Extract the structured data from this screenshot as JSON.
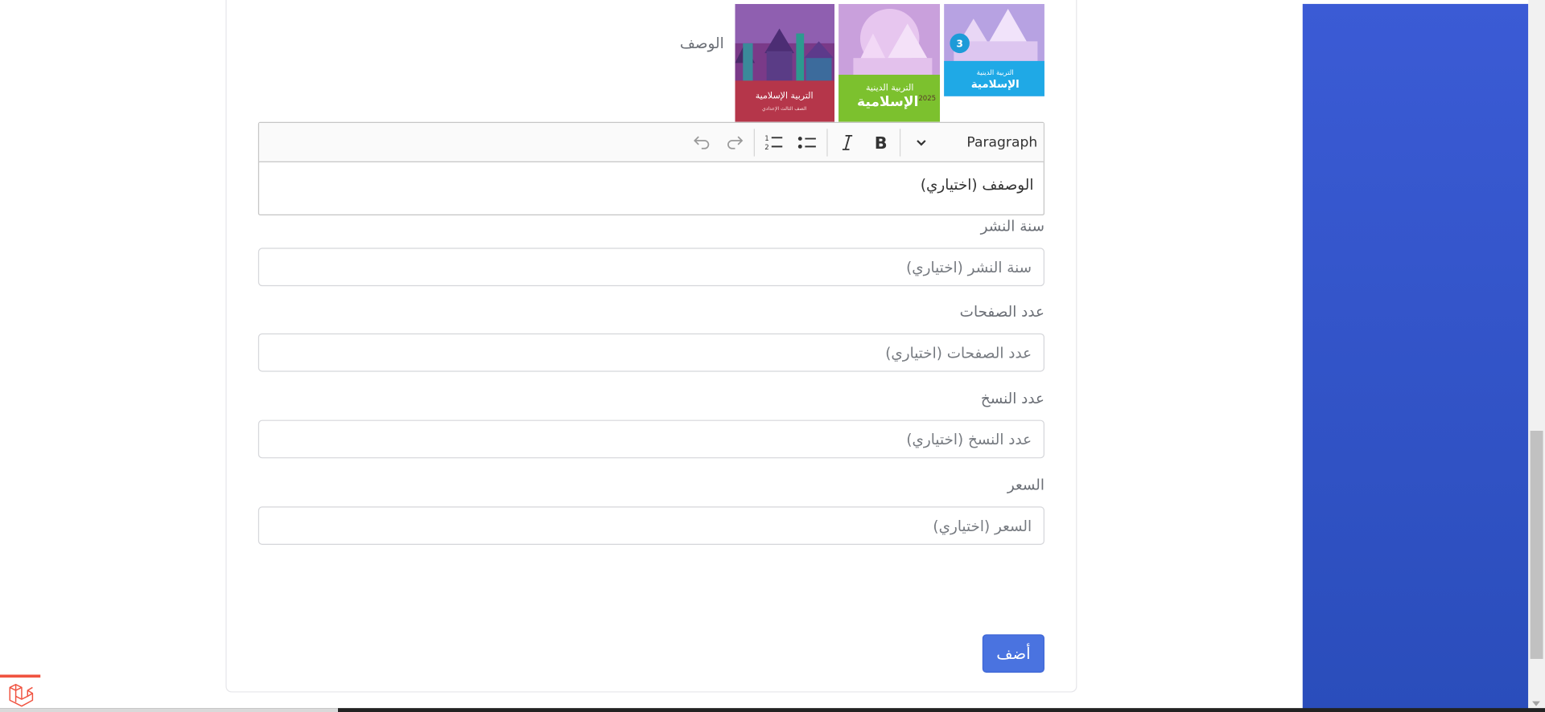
{
  "form": {
    "description_label": "الوصف",
    "editor": {
      "heading_dropdown": "Paragraph",
      "placeholder": "الوصفف (اختياري)"
    },
    "fields": [
      {
        "key": "year",
        "label": "سنة النشر",
        "placeholder": "سنة النشر (اختياري)"
      },
      {
        "key": "pages",
        "label": "عدد الصفحات",
        "placeholder": "عدد الصفحات (اختياري)"
      },
      {
        "key": "copies",
        "label": "عدد النسخ",
        "placeholder": "عدد النسخ (اختياري)"
      },
      {
        "key": "price",
        "label": "السعر",
        "placeholder": "السعر (اختياري)"
      }
    ],
    "submit_label": "أضف"
  },
  "images": [
    {
      "name": "book-cover-1",
      "colors": {
        "bg": "#6c2b8a",
        "accent": "#b5364a"
      }
    },
    {
      "name": "book-cover-2",
      "colors": {
        "bg": "#c48ad6",
        "accent": "#79bf2a"
      }
    },
    {
      "name": "book-cover-3",
      "colors": {
        "bg": "#a98cd6",
        "accent": "#1fa3e0"
      }
    }
  ],
  "colors": {
    "sidebar": "#3b5bd5",
    "primary_button": "#4a73e0",
    "laravel_red": "#f05340"
  }
}
